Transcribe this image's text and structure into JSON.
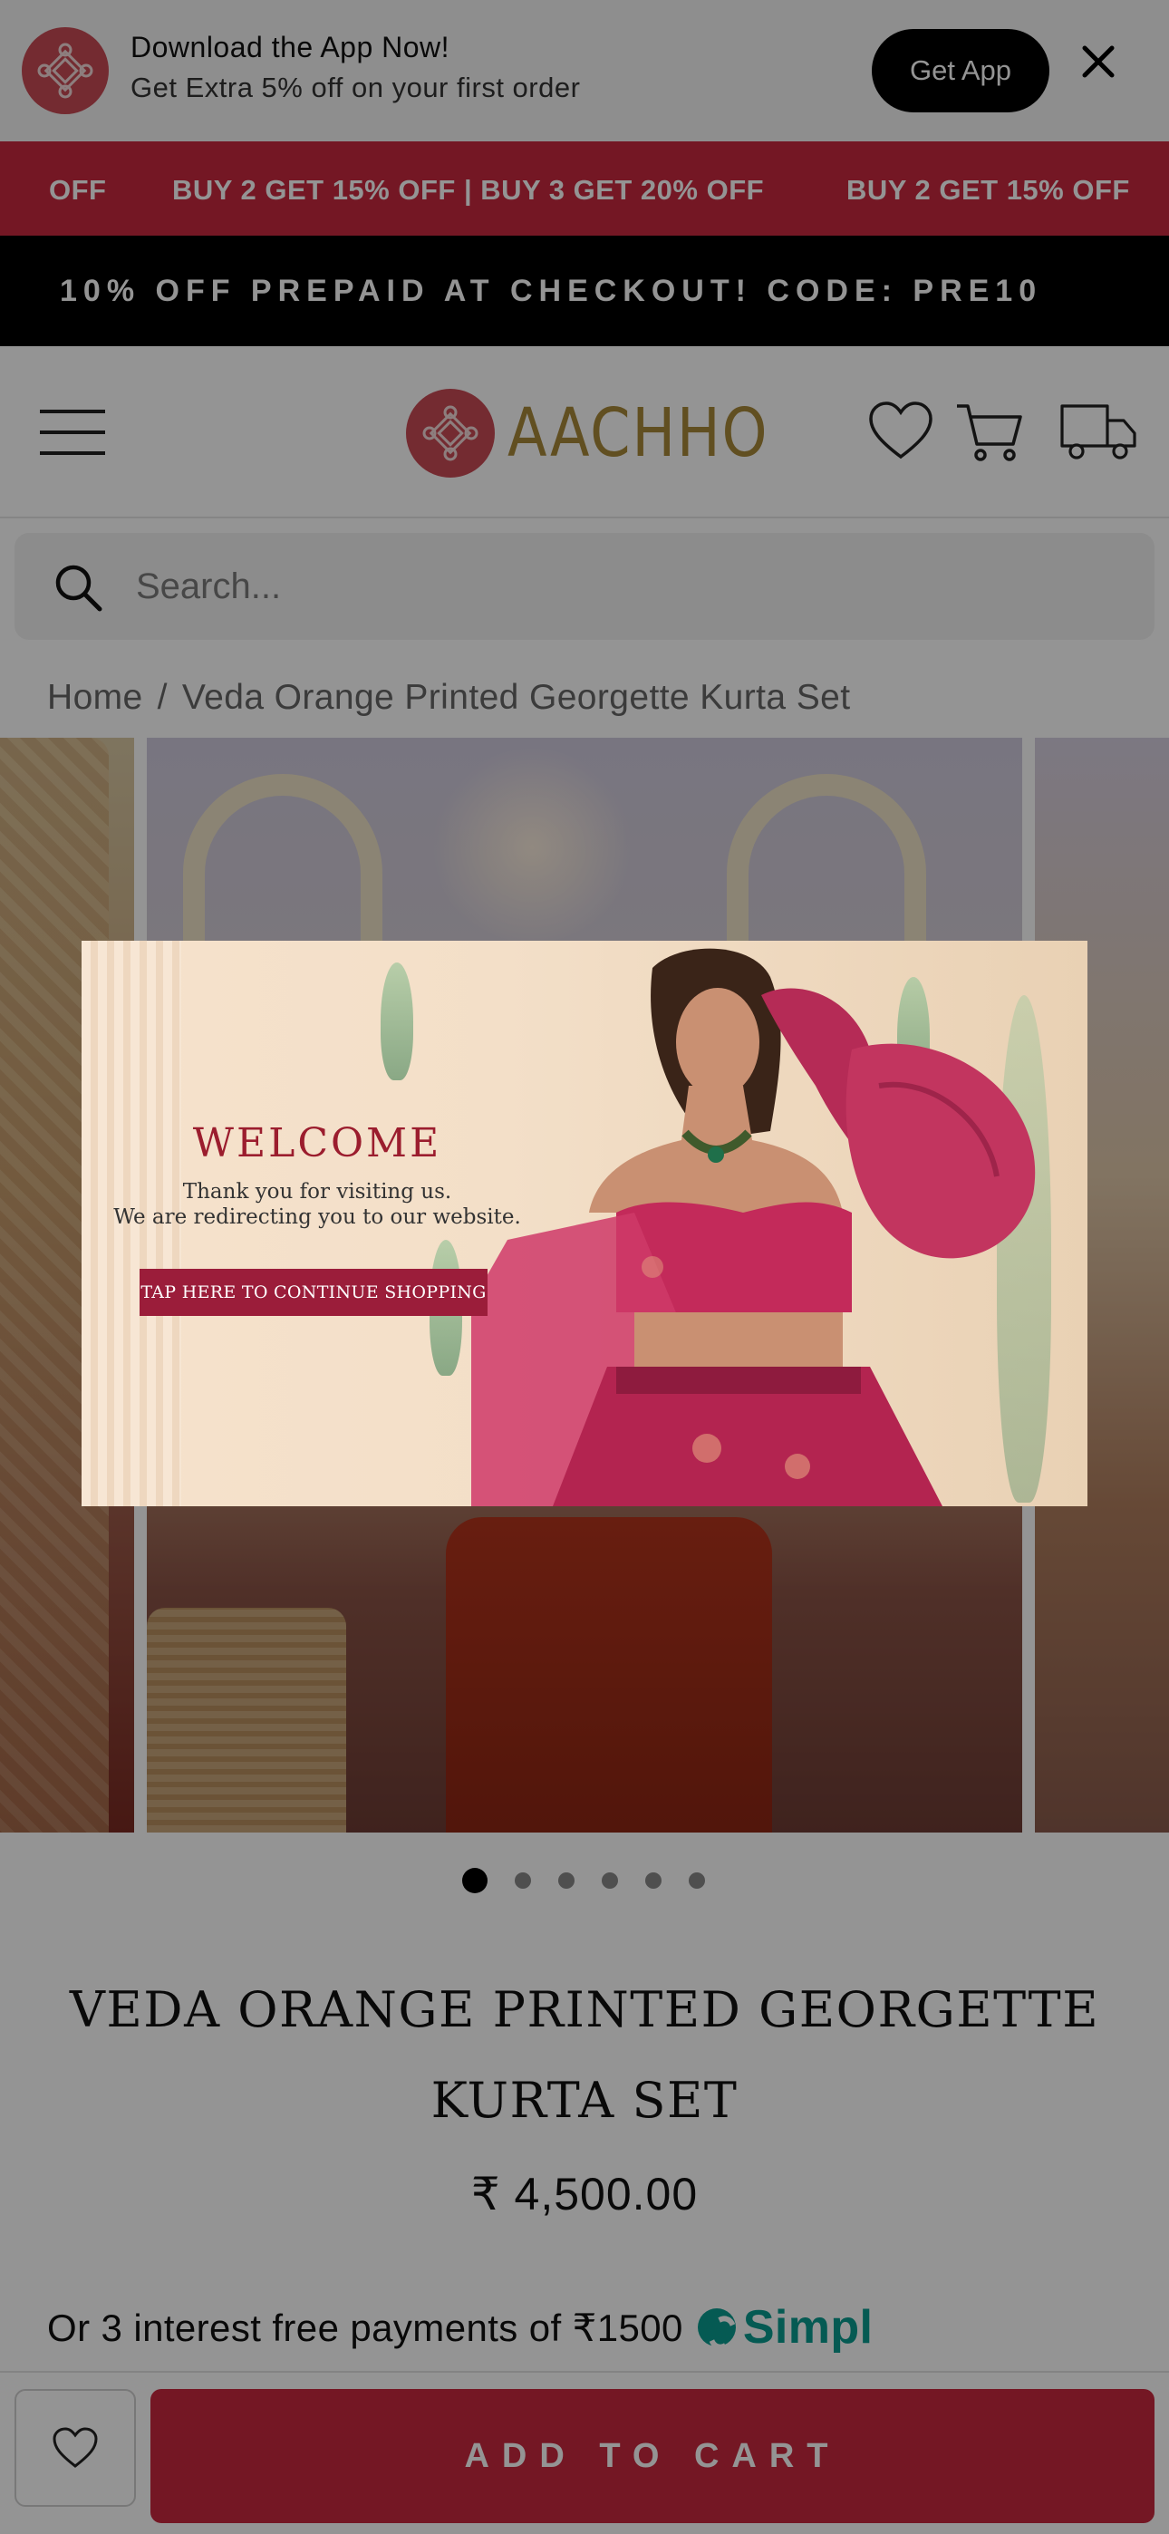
{
  "app_banner": {
    "title": "Download the App Now!",
    "subtitle": "Get Extra 5% off on your first order",
    "button": "Get App"
  },
  "offer_marquee": {
    "items": [
      "OFF",
      "BUY 2 GET 15% OFF | BUY 3 GET 20% OFF",
      "BUY 2 GET 15% OFF"
    ]
  },
  "prepaid_banner": {
    "text": "10% OFF PREPAID AT CHECKOUT! CODE: PRE10"
  },
  "header": {
    "brand": "AACHHO"
  },
  "search": {
    "placeholder": "Search..."
  },
  "breadcrumb": {
    "home": "Home",
    "separator": "/",
    "current": "Veda Orange Printed Georgette Kurta Set"
  },
  "gallery": {
    "slide_count": 6,
    "active_index": 0
  },
  "product": {
    "title": "VEDA ORANGE PRINTED GEORGETTE KURTA SET",
    "price": "₹ 4,500.00",
    "emi_text": "Or 3 interest free payments of ₹1500",
    "emi_provider": "Simpl"
  },
  "bottom_bar": {
    "add_to_cart": "ADD TO CART"
  },
  "popup": {
    "heading": "WELCOME",
    "line1": "Thank you for visiting us.",
    "line2": "We are redirecting you to our website.",
    "button": "TAP HERE TO CONTINUE SHOPPING"
  },
  "colors": {
    "brand_red": "#c8283f",
    "brand_gold": "#a8883a",
    "simpl_teal": "#0a9c8f",
    "popup_maroon": "#9b1d2e"
  }
}
